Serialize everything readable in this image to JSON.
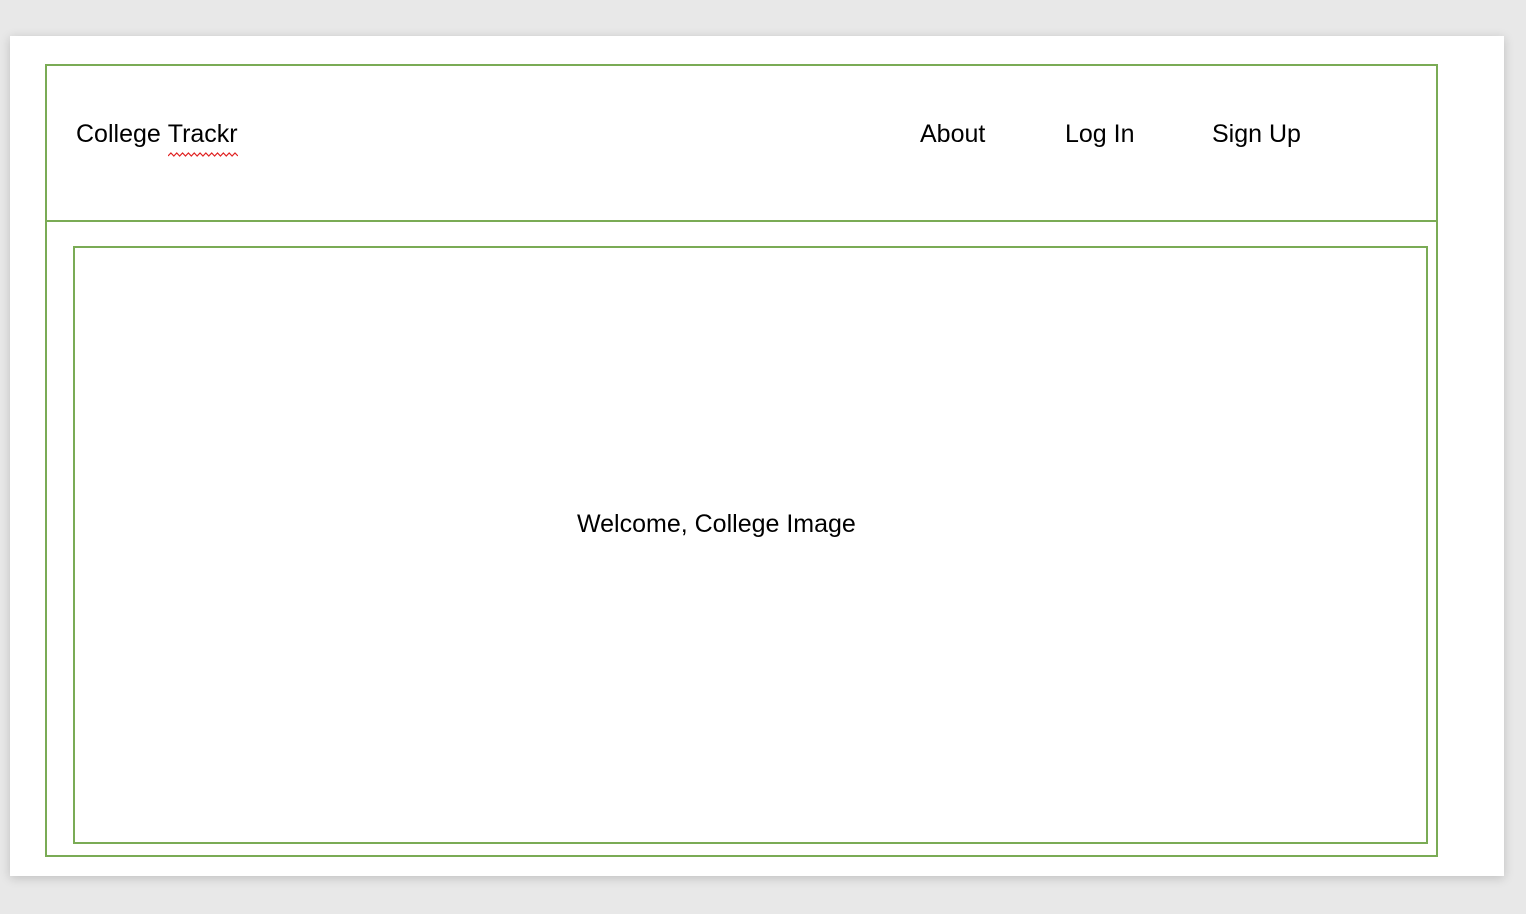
{
  "header": {
    "brand_word1": "College",
    "brand_word2": "Trackr",
    "nav": {
      "about": "About",
      "login": "Log In",
      "signup": "Sign Up"
    }
  },
  "hero": {
    "text": "Welcome, College Image"
  },
  "colors": {
    "frame_border": "#7aab55",
    "spellcheck_underline": "#e02020",
    "text": "#000000"
  }
}
